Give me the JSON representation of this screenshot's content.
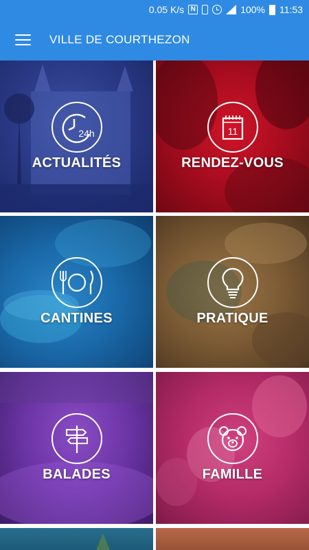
{
  "status_bar": {
    "speed": "0.05 K/s",
    "nfc_icon": "nfc-icon",
    "battery_percent": "100%",
    "time": "11:53"
  },
  "app_bar": {
    "title": "VILLE DE COURTHEZON",
    "menu_icon": "hamburger-menu-icon",
    "color": "#2f8ae4"
  },
  "tiles": [
    {
      "label": "ACTUALITÉS",
      "icon": "clock-24h-icon",
      "icon_text": "24h"
    },
    {
      "label": "RENDEZ-VOUS",
      "icon": "calendar-icon",
      "icon_text": "11"
    },
    {
      "label": "CANTINES",
      "icon": "fork-plate-knife-icon"
    },
    {
      "label": "PRATIQUE",
      "icon": "lightbulb-icon"
    },
    {
      "label": "BALADES",
      "icon": "signpost-icon"
    },
    {
      "label": "FAMILLE",
      "icon": "bear-face-icon"
    }
  ]
}
